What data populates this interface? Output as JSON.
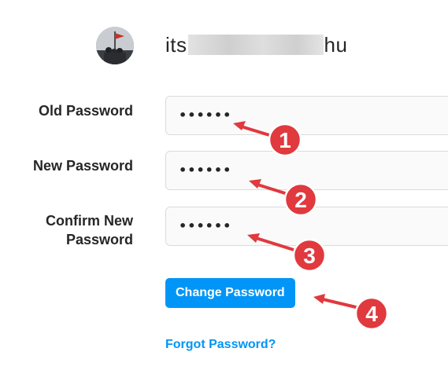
{
  "header": {
    "username_prefix": "its",
    "username_suffix": "hu"
  },
  "form": {
    "old_password": {
      "label": "Old Password",
      "value": "••••••"
    },
    "new_password": {
      "label": "New Password",
      "value": "••••••"
    },
    "confirm_password": {
      "label_line1": "Confirm New",
      "label_line2": "Password",
      "value": "••••••"
    },
    "submit_label": "Change Password",
    "forgot_label": "Forgot Password?"
  },
  "annotations": {
    "color": "#e0393e",
    "steps": [
      "1",
      "2",
      "3",
      "4"
    ]
  },
  "colors": {
    "accent": "#0095f6",
    "field_bg": "#fafafa",
    "field_border": "#dbdbdb"
  }
}
